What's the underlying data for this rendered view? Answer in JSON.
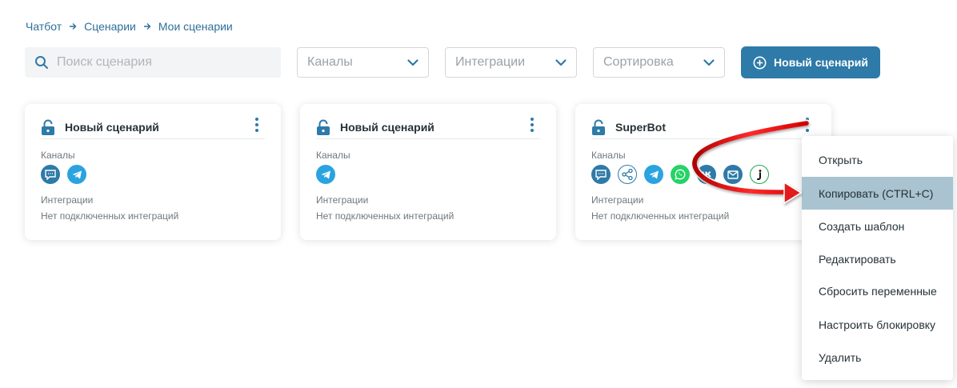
{
  "breadcrumb": {
    "items": [
      "Чатбот",
      "Сценарии",
      "Мои сценарии"
    ]
  },
  "search": {
    "placeholder": "Поиск сценария"
  },
  "filters": [
    {
      "placeholder": "Каналы"
    },
    {
      "placeholder": "Интеграции"
    },
    {
      "placeholder": "Сортировка"
    }
  ],
  "new_button": {
    "label": "Новый сценарий"
  },
  "cards": [
    {
      "title": "Новый сценарий",
      "channels_label": "Каналы",
      "integrations_label": "Интеграции",
      "integrations_value": "Нет подключенных интеграций",
      "channels": [
        "chat-widget-icon",
        "telegram-icon"
      ]
    },
    {
      "title": "Новый сценарий",
      "channels_label": "Каналы",
      "integrations_label": "Интеграции",
      "integrations_value": "Нет подключенных интеграций",
      "channels": [
        "telegram-icon"
      ]
    },
    {
      "title": "SuperBot",
      "channels_label": "Каналы",
      "integrations_label": "Интеграции",
      "integrations_value": "Нет подключенных интеграций",
      "channels": [
        "chat-widget-icon",
        "share-icon",
        "telegram-icon",
        "whatsapp-icon",
        "vk-icon",
        "email-icon",
        "jivo-icon"
      ]
    }
  ],
  "context_menu": {
    "items": [
      "Открыть",
      "Копировать (CTRL+C)",
      "Создать шаблон",
      "Редактировать",
      "Сбросить переменные",
      "Настроить блокировку",
      "Удалить"
    ],
    "active_index": 1
  },
  "colors": {
    "primary": "#2e7aa8",
    "link": "#2e6f9a",
    "menu_highlight": "#a9c3d0",
    "annotation_arrow": "#e21b1b"
  }
}
